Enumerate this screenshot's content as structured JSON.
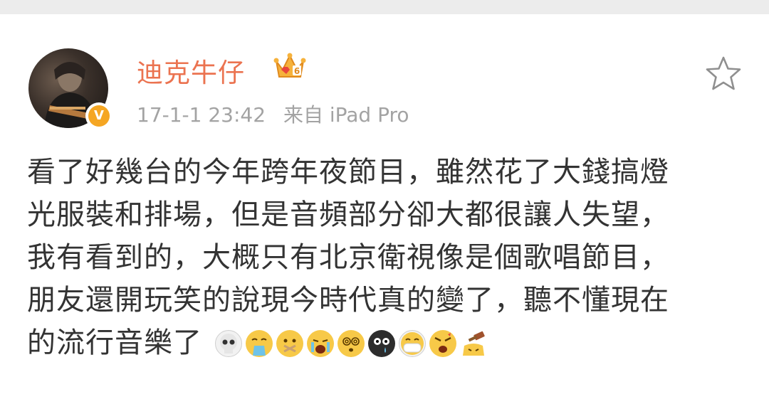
{
  "post": {
    "author": "迪克牛仔",
    "timestamp": "17-1-1 23:42",
    "source": "来自 iPad Pro",
    "verified_badge": "V",
    "lines": [
      "看了好幾台的今年跨年夜節目，雖然花了大錢搞燈",
      "光服裝和排場，但是音頻部分卻大都很讓人失望，",
      "我有看到的，大概只有北京衛視像是個歌唱節目，",
      "朋友還開玩笑的說現今時代真的變了，聽不懂現在",
      "的流行音樂了"
    ],
    "emojis": [
      "skull-icon",
      "vomit-face-icon",
      "sealed-mouth-face-icon",
      "crying-loud-face-icon",
      "dizzy-eyes-face-icon",
      "black-dizzy-face-icon",
      "mask-face-icon",
      "angry-face-icon",
      "hammer-hit-face-icon"
    ]
  },
  "colors": {
    "author": "#eb7350",
    "meta": "#a3a3a3",
    "text": "#333333",
    "verified": "#f5a623"
  }
}
